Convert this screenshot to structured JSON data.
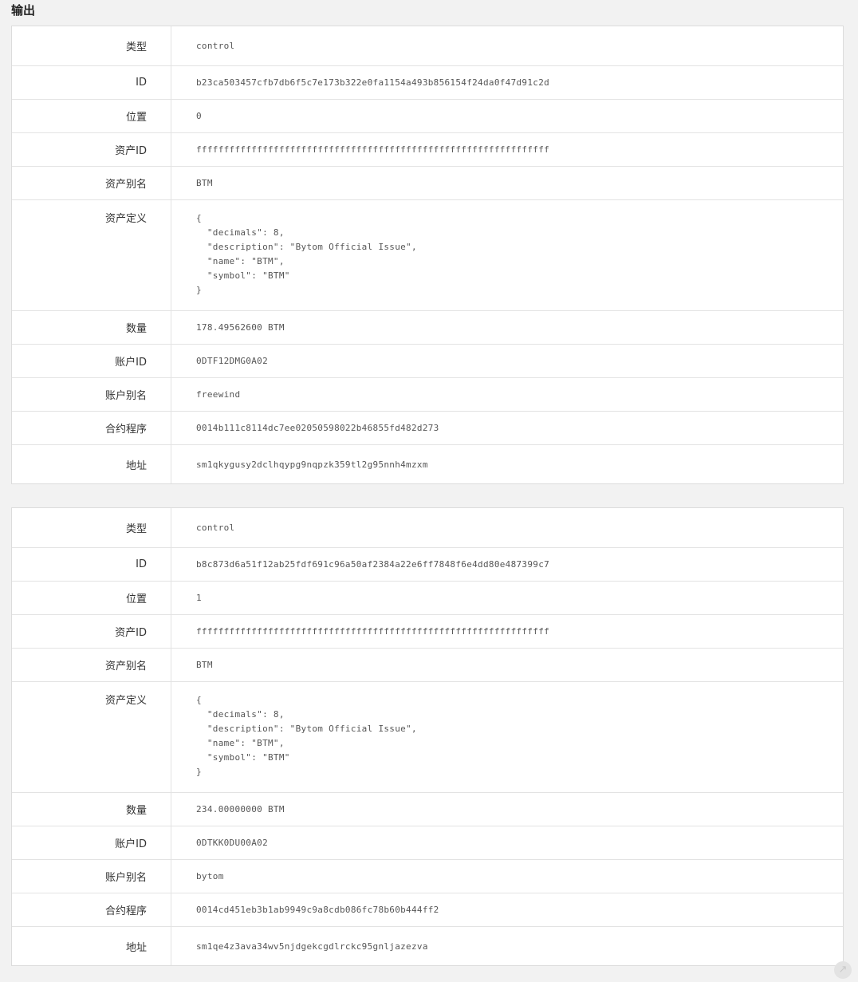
{
  "section_title": "输出",
  "outputs": [
    {
      "type": {
        "label": "类型",
        "value": "control"
      },
      "id": {
        "label": "ID",
        "value": "b23ca503457cfb7db6f5c7e173b322e0fa1154a493b856154f24da0f47d91c2d"
      },
      "position": {
        "label": "位置",
        "value": "0"
      },
      "asset_id": {
        "label": "资产ID",
        "value": "ffffffffffffffffffffffffffffffffffffffffffffffffffffffffffffffff"
      },
      "asset_alias": {
        "label": "资产别名",
        "value": "BTM"
      },
      "asset_definition": {
        "label": "资产定义",
        "value": "{\n  \"decimals\": 8,\n  \"description\": \"Bytom Official Issue\",\n  \"name\": \"BTM\",\n  \"symbol\": \"BTM\"\n}"
      },
      "amount": {
        "label": "数量",
        "value": "178.49562600 BTM"
      },
      "account_id": {
        "label": "账户ID",
        "value": "0DTF12DMG0A02"
      },
      "account_alias": {
        "label": "账户别名",
        "value": "freewind"
      },
      "control_program": {
        "label": "合约程序",
        "value": "0014b111c8114dc7ee02050598022b46855fd482d273"
      },
      "address": {
        "label": "地址",
        "value": "sm1qkygusy2dclhqypg9nqpzk359tl2g95nnh4mzxm"
      }
    },
    {
      "type": {
        "label": "类型",
        "value": "control"
      },
      "id": {
        "label": "ID",
        "value": "b8c873d6a51f12ab25fdf691c96a50af2384a22e6ff7848f6e4dd80e487399c7"
      },
      "position": {
        "label": "位置",
        "value": "1"
      },
      "asset_id": {
        "label": "资产ID",
        "value": "ffffffffffffffffffffffffffffffffffffffffffffffffffffffffffffffff"
      },
      "asset_alias": {
        "label": "资产别名",
        "value": "BTM"
      },
      "asset_definition": {
        "label": "资产定义",
        "value": "{\n  \"decimals\": 8,\n  \"description\": \"Bytom Official Issue\",\n  \"name\": \"BTM\",\n  \"symbol\": \"BTM\"\n}"
      },
      "amount": {
        "label": "数量",
        "value": "234.00000000 BTM"
      },
      "account_id": {
        "label": "账户ID",
        "value": "0DTKK0DU00A02"
      },
      "account_alias": {
        "label": "账户别名",
        "value": "bytom"
      },
      "control_program": {
        "label": "合约程序",
        "value": "0014cd451eb3b1ab9949c9a8cdb086fc78b60b444ff2"
      },
      "address": {
        "label": "地址",
        "value": "sm1qe4z3ava34wv5njdgekcgdlrckc95gnljazezva"
      }
    }
  ],
  "corner_icon": "scroll-indicator-icon"
}
